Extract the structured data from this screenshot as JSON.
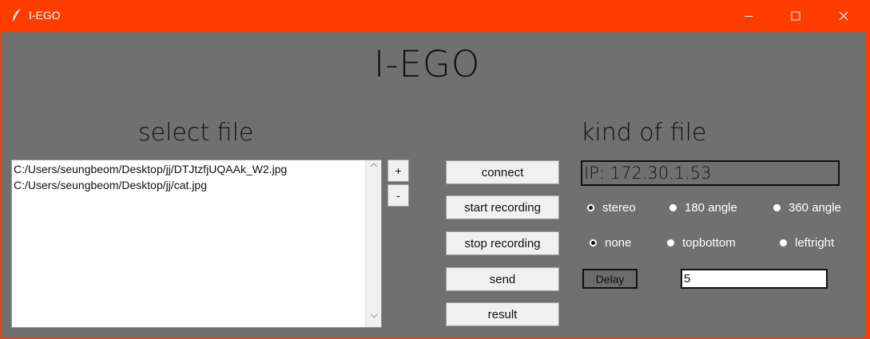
{
  "window": {
    "title": "I-EGO",
    "minimize_label": "—",
    "maximize_label": "☐",
    "close_label": "✕",
    "accent_color": "#ff3c00",
    "background_color": "#707070"
  },
  "app": {
    "title": "I-EGO"
  },
  "file_panel": {
    "heading": "select file",
    "files": [
      "C:/Users/seungbeom/Desktop/jj/DTJtzfjUQAAk_W2.jpg",
      "C:/Users/seungbeom/Desktop/jj/cat.jpg"
    ],
    "add_label": "+",
    "remove_label": "-",
    "scroll_up_icon": "chevron-up-icon",
    "scroll_down_icon": "chevron-down-icon"
  },
  "actions": {
    "connect": "connect",
    "start_recording": "start recording",
    "stop_recording": "stop recording",
    "send": "send",
    "result": "result"
  },
  "kind_panel": {
    "heading": "kind of file",
    "ip_text": "IP: 172.30.1.53",
    "view_options": [
      {
        "label": "stereo",
        "selected": true
      },
      {
        "label": "180 angle",
        "selected": false
      },
      {
        "label": "360 angle",
        "selected": false
      }
    ],
    "layout_options": [
      {
        "label": "none",
        "selected": true
      },
      {
        "label": "topbottom",
        "selected": false
      },
      {
        "label": "leftright",
        "selected": false
      }
    ],
    "delay_label": "Delay",
    "delay_value": "5"
  }
}
